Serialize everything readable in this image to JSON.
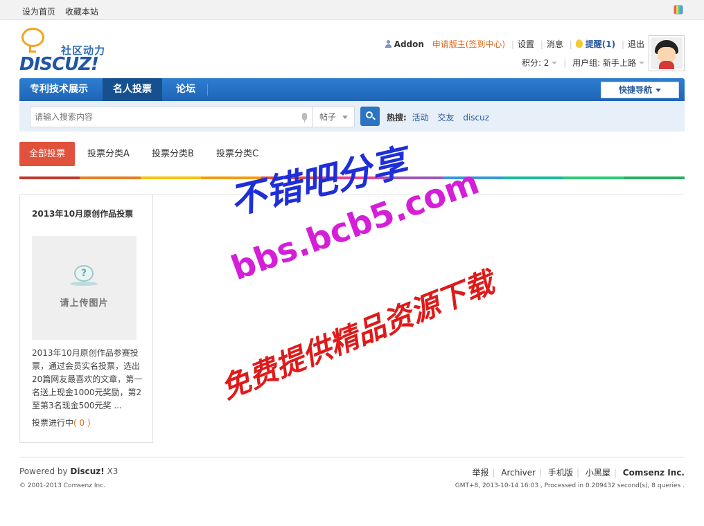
{
  "topbar": {
    "set_home": "设为首页",
    "bookmark": "收藏本站"
  },
  "logo": {
    "slogan": "社区动力",
    "brand": "DISCUZ!"
  },
  "user": {
    "name": "Addon",
    "apply": "申请版主(签到中心)",
    "settings": "设置",
    "messages": "消息",
    "remind": "提醒(1)",
    "logout": "退出",
    "points": "积分: 2",
    "group": "用户组: 新手上路"
  },
  "nav": {
    "items": [
      {
        "label": "专利技术展示"
      },
      {
        "label": "名人投票"
      },
      {
        "label": "论坛"
      }
    ],
    "quick": "快捷导航"
  },
  "search": {
    "placeholder": "请输入搜索内容",
    "type": "帖子",
    "hot_label": "热搜:",
    "hot": [
      "活动",
      "交友",
      "discuz"
    ]
  },
  "tabs": [
    "全部投票",
    "投票分类A",
    "投票分类B",
    "投票分类C"
  ],
  "rainbow_colors": [
    "#c0392b",
    "#e67e22",
    "#f1c40f",
    "#f39c12",
    "#e74c3c",
    "#e84393",
    "#9b59b6",
    "#3498db",
    "#1abc9c",
    "#2ecc71",
    "#27ae60"
  ],
  "card": {
    "title": "2013年10月原创作品投票",
    "placeholder": "请上传图片",
    "description": "2013年10月原创作品参赛投票，通过会员实名投票，选出20篇网友最喜欢的文章，第一名送上现金1000元奖励，第2至第3名现金500元奖 ...",
    "status_label": "投票进行中",
    "status_count": "( 0 )"
  },
  "watermark": {
    "line1": "不错吧分享",
    "line2": "bbs.bcb5.com",
    "line3": "免费提供精品资源下载"
  },
  "footer": {
    "powered_by": "Powered by",
    "product": "Discuz!",
    "version": "X3",
    "copyright": "© 2001-2013 Comsenz Inc.",
    "links": [
      "举报",
      "Archiver",
      "手机版",
      "小黑屋"
    ],
    "company": "Comsenz Inc.",
    "gmt": "GMT+8, 2013-10-14 16:03 , Processed in 0.209432 second(s), 8 queries ."
  }
}
